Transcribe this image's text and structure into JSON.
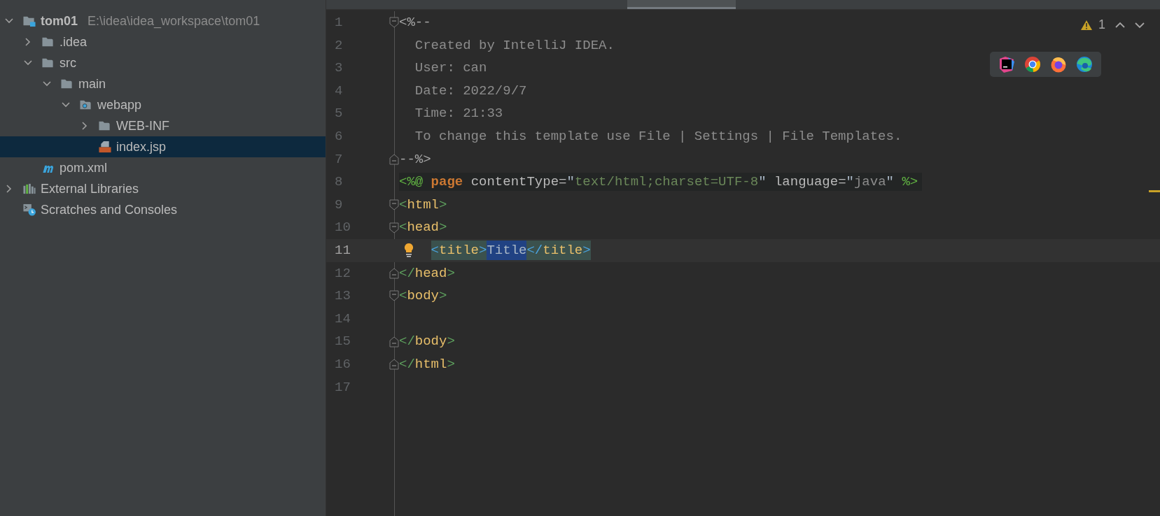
{
  "project_tree": [
    {
      "name": "tom01",
      "path": "E:\\idea\\idea_workspace\\tom01",
      "kind": "module",
      "expanded": true,
      "selected": false,
      "children": [
        {
          "name": ".idea",
          "kind": "folder",
          "expanded": false,
          "selected": false
        },
        {
          "name": "src",
          "kind": "folder",
          "expanded": true,
          "selected": false,
          "children": [
            {
              "name": "main",
              "kind": "folder",
              "expanded": true,
              "selected": false,
              "children": [
                {
                  "name": "webapp",
                  "kind": "web-folder",
                  "expanded": true,
                  "selected": false,
                  "children": [
                    {
                      "name": "WEB-INF",
                      "kind": "folder",
                      "expanded": false,
                      "selected": false
                    },
                    {
                      "name": "index.jsp",
                      "kind": "jsp",
                      "selected": true
                    }
                  ]
                }
              ]
            }
          ]
        },
        {
          "name": "pom.xml",
          "kind": "maven",
          "selected": false
        }
      ]
    },
    {
      "name": "External Libraries",
      "kind": "libraries",
      "expanded": false,
      "selected": false
    },
    {
      "name": "Scratches and Consoles",
      "kind": "scratches",
      "selected": false
    }
  ],
  "editor": {
    "inspections": {
      "warnings": "1"
    },
    "lines": [
      {
        "number": "1",
        "fold_start": true,
        "current": false,
        "tokens": [
          {
            "kind": "comment-delim",
            "text": "<%--"
          }
        ]
      },
      {
        "number": "2",
        "current": false,
        "tokens": [
          {
            "kind": "comment",
            "text": "  Created by IntelliJ IDEA."
          }
        ]
      },
      {
        "number": "3",
        "current": false,
        "tokens": [
          {
            "kind": "comment",
            "text": "  User: can"
          }
        ]
      },
      {
        "number": "4",
        "current": false,
        "tokens": [
          {
            "kind": "comment",
            "text": "  Date: 2022/9/7"
          }
        ]
      },
      {
        "number": "5",
        "current": false,
        "tokens": [
          {
            "kind": "comment",
            "text": "  Time: 21:33"
          }
        ]
      },
      {
        "number": "6",
        "current": false,
        "tokens": [
          {
            "kind": "comment",
            "text": "  To change this template use File | Settings | File Templates."
          }
        ]
      },
      {
        "number": "7",
        "fold_end": true,
        "current": false,
        "tokens": [
          {
            "kind": "comment-delim",
            "text": "--%>"
          }
        ]
      },
      {
        "number": "8",
        "current": false,
        "injected": true,
        "tokens": [
          {
            "kind": "directive",
            "text": "<%@"
          },
          {
            "kind": "keyword",
            "text": " page"
          },
          {
            "kind": "attr",
            "text": " contentType="
          },
          {
            "kind": "plain",
            "text": "\""
          },
          {
            "kind": "string",
            "text": "text/html;charset=UTF-8"
          },
          {
            "kind": "plain",
            "text": "\""
          },
          {
            "kind": "attr",
            "text": " language="
          },
          {
            "kind": "plain",
            "text": "\""
          },
          {
            "kind": "string-dim",
            "text": "java"
          },
          {
            "kind": "plain",
            "text": "\""
          },
          {
            "kind": "directive",
            "text": " %>"
          }
        ]
      },
      {
        "number": "9",
        "fold_start": true,
        "current": false,
        "tokens": [
          {
            "kind": "bracket",
            "text": "<"
          },
          {
            "kind": "tagname",
            "text": "html"
          },
          {
            "kind": "bracket",
            "text": ">"
          }
        ]
      },
      {
        "number": "10",
        "fold_start": true,
        "current": false,
        "tokens": [
          {
            "kind": "bracket",
            "text": "<"
          },
          {
            "kind": "tagname",
            "text": "head"
          },
          {
            "kind": "bracket",
            "text": ">"
          }
        ]
      },
      {
        "number": "11",
        "current": true,
        "intention": true,
        "tokens": [
          {
            "kind": "bracket-match",
            "match_highlight": true,
            "text": "<"
          },
          {
            "kind": "tagname",
            "match_highlight": true,
            "text": "title"
          },
          {
            "kind": "bracket-match",
            "match_highlight": true,
            "text": ">"
          },
          {
            "kind": "text",
            "selection": true,
            "text": "Title"
          },
          {
            "kind": "bracket-match",
            "match_highlight": true,
            "text": "</"
          },
          {
            "kind": "tagname",
            "match_highlight": true,
            "text": "title"
          },
          {
            "kind": "bracket-match",
            "match_highlight": true,
            "text": ">"
          }
        ]
      },
      {
        "number": "12",
        "fold_end": true,
        "current": false,
        "tokens": [
          {
            "kind": "bracket",
            "text": "</"
          },
          {
            "kind": "tagname",
            "text": "head"
          },
          {
            "kind": "bracket",
            "text": ">"
          }
        ]
      },
      {
        "number": "13",
        "fold_start": true,
        "current": false,
        "tokens": [
          {
            "kind": "bracket",
            "text": "<"
          },
          {
            "kind": "tagname",
            "text": "body"
          },
          {
            "kind": "bracket",
            "text": ">"
          }
        ]
      },
      {
        "number": "14",
        "current": false
      },
      {
        "number": "15",
        "fold_end": true,
        "current": false,
        "tokens": [
          {
            "kind": "bracket",
            "text": "</"
          },
          {
            "kind": "tagname",
            "text": "body"
          },
          {
            "kind": "bracket",
            "text": ">"
          }
        ]
      },
      {
        "number": "16",
        "fold_end": true,
        "current": false,
        "tokens": [
          {
            "kind": "bracket",
            "text": "</"
          },
          {
            "kind": "tagname",
            "text": "html"
          },
          {
            "kind": "bracket",
            "text": ">"
          }
        ]
      },
      {
        "number": "17",
        "current": false
      }
    ],
    "browser_icons": [
      {
        "kind": "intellij"
      },
      {
        "kind": "chrome"
      },
      {
        "kind": "firefox"
      },
      {
        "kind": "edge"
      }
    ]
  }
}
